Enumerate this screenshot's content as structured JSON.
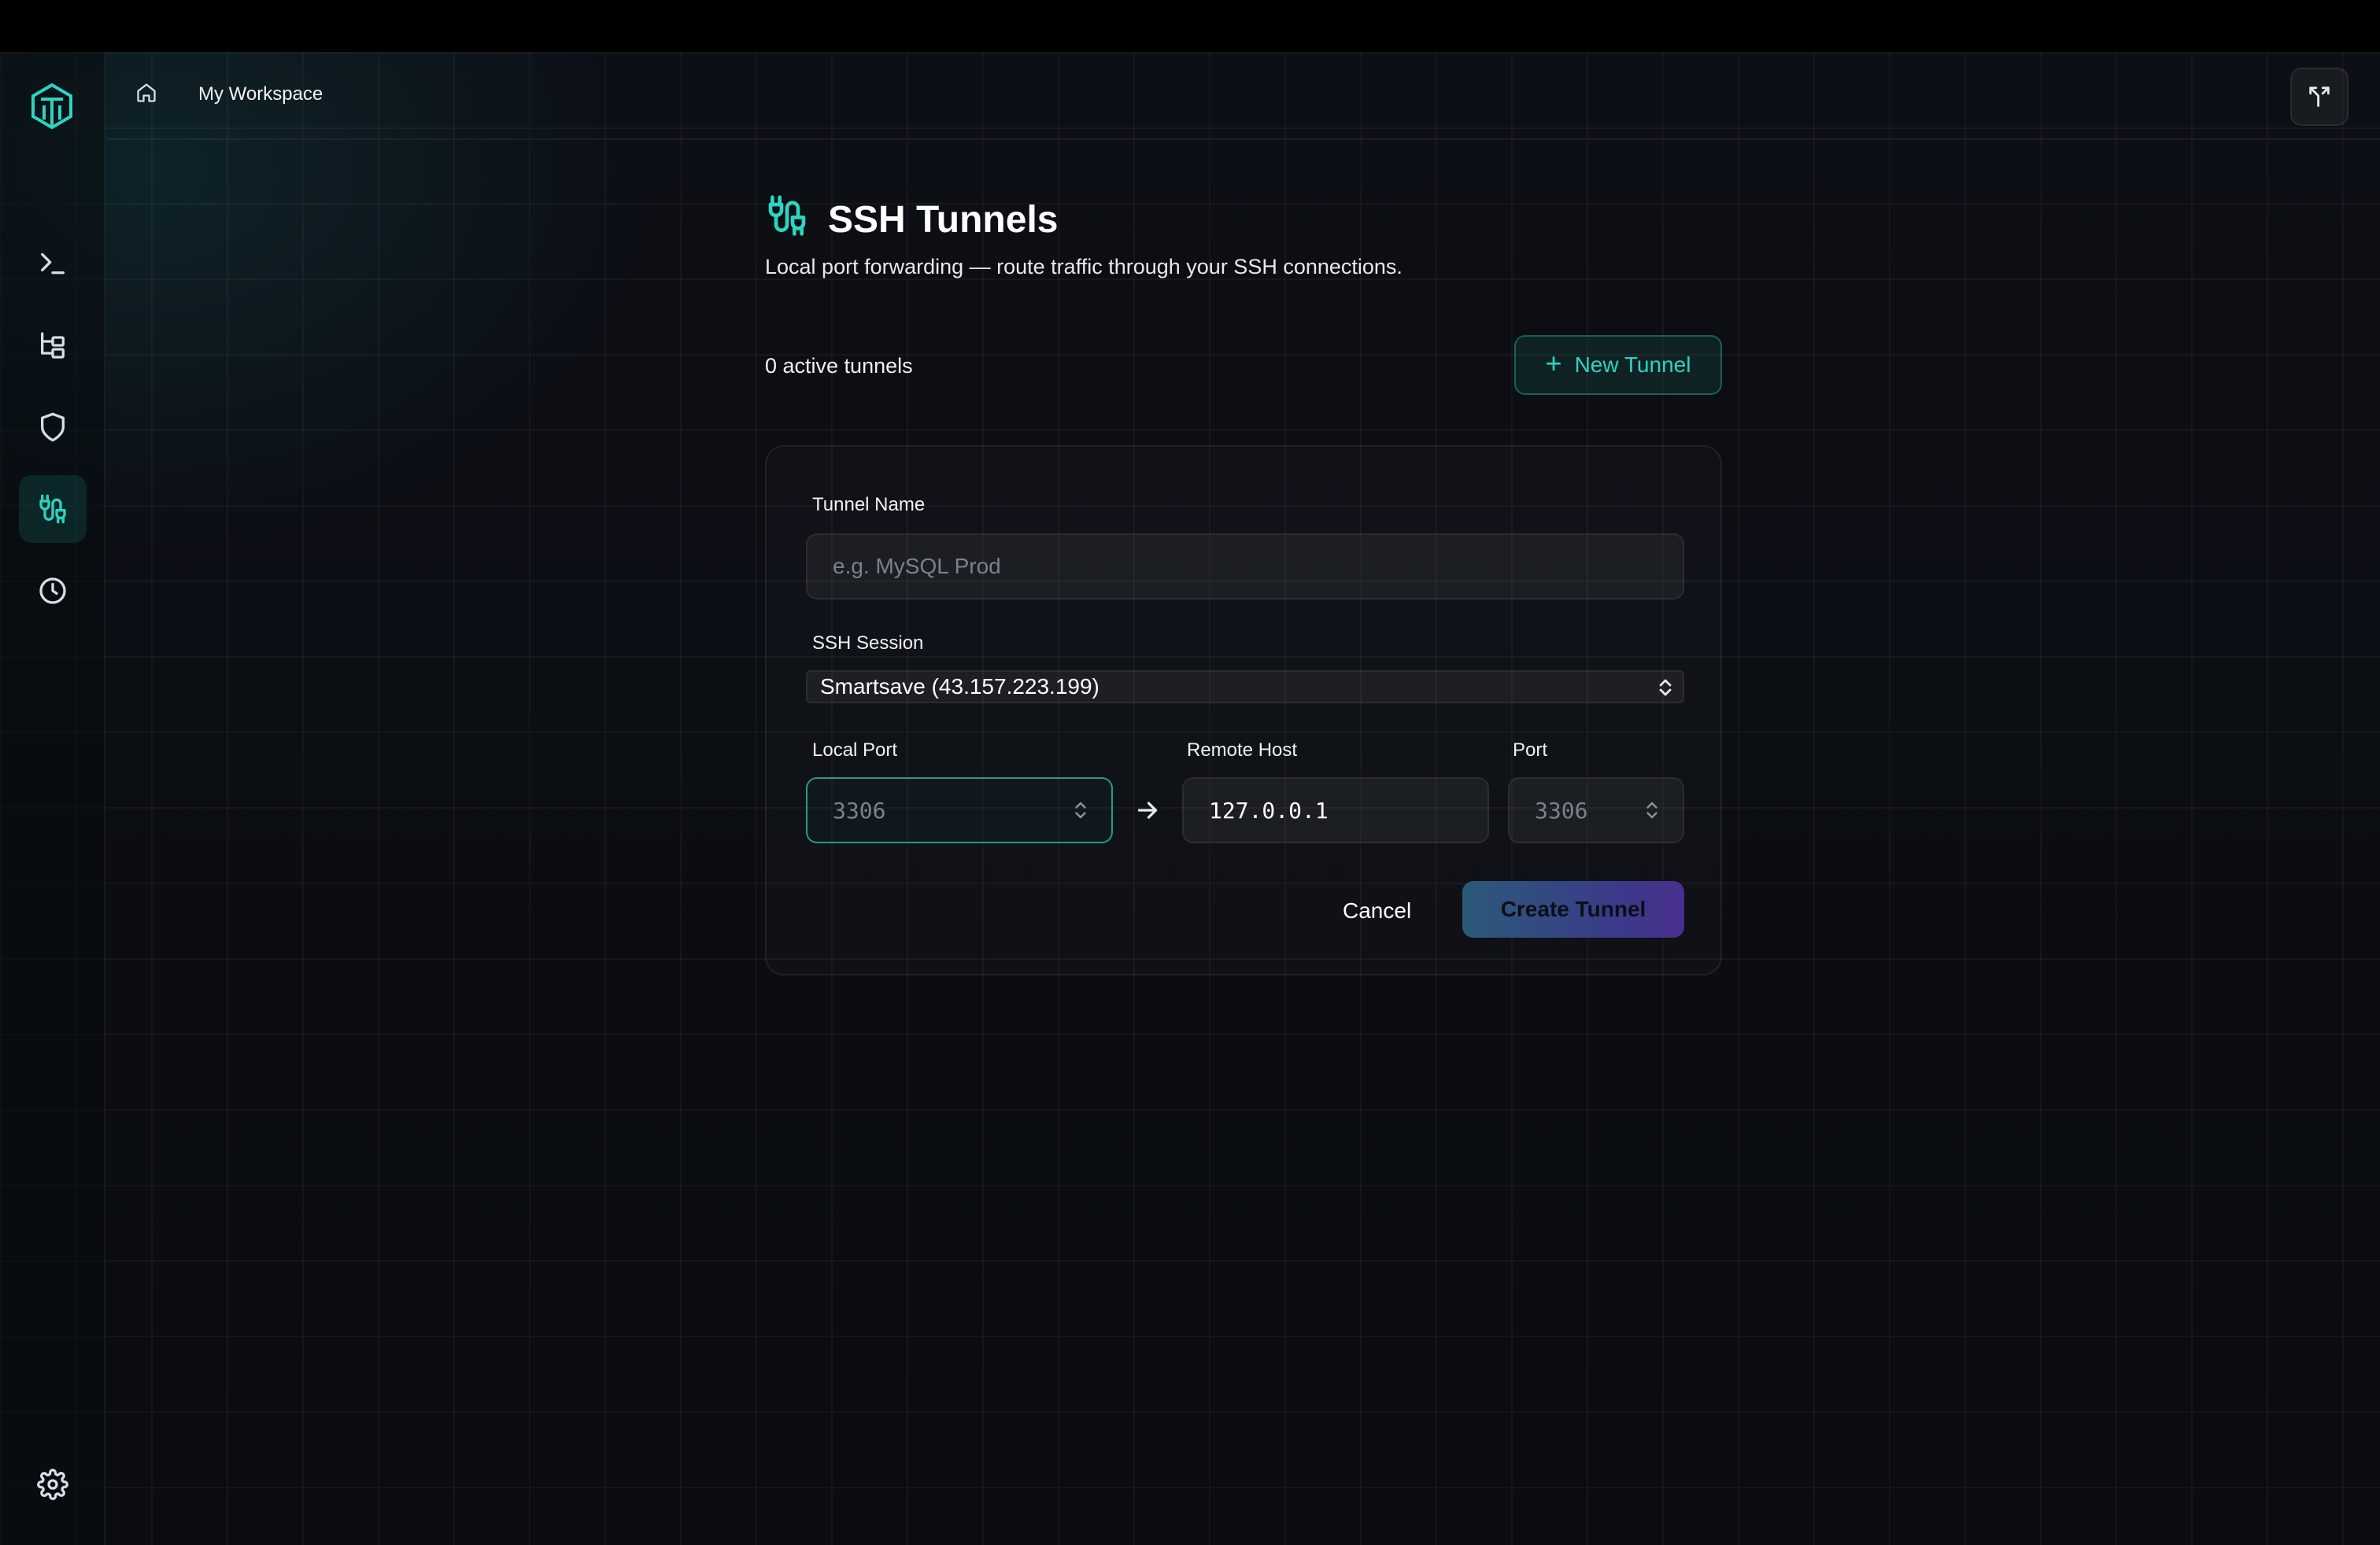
{
  "header": {
    "breadcrumb": "My Workspace"
  },
  "sidebar": {
    "items": [
      {
        "icon": "terminal-icon",
        "active": false
      },
      {
        "icon": "file-tree-icon",
        "active": false
      },
      {
        "icon": "shield-icon",
        "active": false
      },
      {
        "icon": "tunnel-icon",
        "active": true
      },
      {
        "icon": "clock-icon",
        "active": false
      }
    ],
    "bottom_icon": "gear-icon"
  },
  "page": {
    "title": "SSH Tunnels",
    "subtitle": "Local port forwarding — route traffic through your SSH connections.",
    "count_text": "0 active tunnels",
    "new_button": "New Tunnel"
  },
  "form": {
    "name_label": "Tunnel Name",
    "name_placeholder": "e.g. MySQL Prod",
    "session_label": "SSH Session",
    "session_value": "Smartsave (43.157.223.199)",
    "local_port_label": "Local Port",
    "local_port_placeholder": "3306",
    "remote_host_label": "Remote Host",
    "remote_host_value": "127.0.0.1",
    "port_label": "Port",
    "port_placeholder": "3306",
    "cancel": "Cancel",
    "create": "Create Tunnel"
  },
  "colors": {
    "accent": "#2dd4bf",
    "background": "#0a0c11"
  }
}
